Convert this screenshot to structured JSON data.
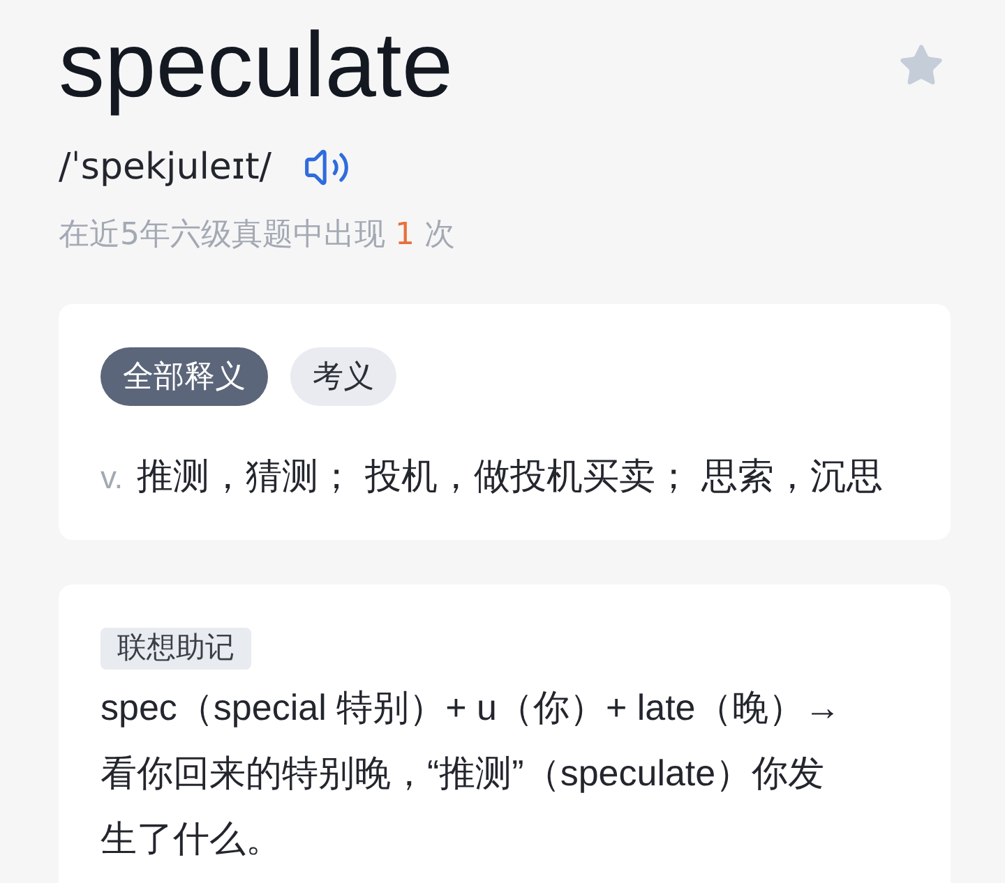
{
  "header": {
    "headword": "speculate",
    "favorited": false,
    "phonetic": "/ˈspekjuleɪt/",
    "exam_frequency": {
      "prefix": "在近5年六级真题中出现",
      "count": "1",
      "suffix": "次"
    }
  },
  "definitions": {
    "tabs": [
      {
        "label": "全部释义",
        "selected": true
      },
      {
        "label": "考义",
        "selected": false
      }
    ],
    "senses": [
      {
        "pos": "v.",
        "meaning": "推测，猜测； 投机，做投机买卖； 思索，沉思"
      }
    ]
  },
  "mnemonic": {
    "tag": "联想助记",
    "text": "spec（special 特别）+ u（你）+ late（晚）→看你回来的特别晚，“推测”（speculate）你发生了什么。"
  }
}
